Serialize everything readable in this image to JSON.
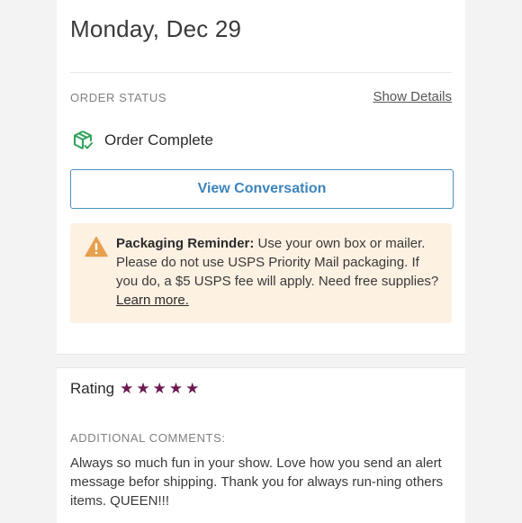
{
  "order": {
    "date": "Monday, Dec 29",
    "status_label": "ORDER STATUS",
    "show_details": "Show Details",
    "status_text": "Order Complete",
    "view_conversation": "View Conversation"
  },
  "reminder": {
    "title": "Packaging Reminder:",
    "body": " Use your own box or mailer. Please do not use USPS Priority Mail packaging. If you do, a $5 USPS fee will apply. Need free supplies? ",
    "link": "Learn more."
  },
  "rating": {
    "label": "Rating",
    "stars": 5,
    "star_color": "#6b1a52"
  },
  "comments": {
    "label": "ADDITIONAL COMMENTS:",
    "text": "Always so much fun in your show. Love how you send an alert message befor shipping. Thank you for always run-ning others items. QUEEN!!!"
  },
  "icons": {
    "status": "package-check-icon",
    "warning": "warning-triangle-icon",
    "star": "star-icon"
  },
  "colors": {
    "accent": "#3c84bd",
    "reminder_bg": "#fdf1e2",
    "status_green": "#2fa35a",
    "warning_orange": "#e8a04c"
  }
}
